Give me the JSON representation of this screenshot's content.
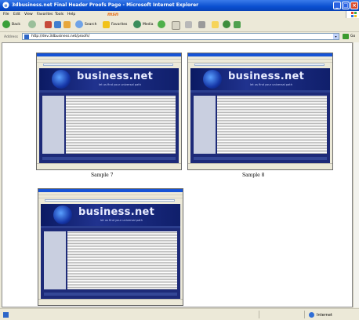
{
  "window": {
    "title": "3dbusiness.net Final Header Proofs Page - Microsoft Internet Explorer"
  },
  "menu": {
    "items": [
      "File",
      "Edit",
      "View",
      "Favorites",
      "Tools",
      "Help"
    ],
    "msn_label": "msn"
  },
  "toolbar": {
    "back_label": "Back",
    "search_label": "Search",
    "favorites_label": "Favorites",
    "media_label": "Media"
  },
  "address": {
    "label": "Address",
    "url": "http://dev.3dbusiness.net/proofs/",
    "go_label": "Go"
  },
  "thumbnails": [
    {
      "brand": "business.net",
      "slogan": "let us find your universal path",
      "caption": "Sample 7"
    },
    {
      "brand": "business.net",
      "slogan": "let us find your universal path",
      "caption": "Sample 8"
    },
    {
      "brand": "business.net",
      "slogan": "let us find your universal path",
      "caption": ""
    }
  ],
  "status": {
    "zone": "Internet"
  },
  "colors": {
    "titlebar": "#0a4fd0",
    "chrome": "#ece9d8",
    "banner": "#0b1a63"
  }
}
